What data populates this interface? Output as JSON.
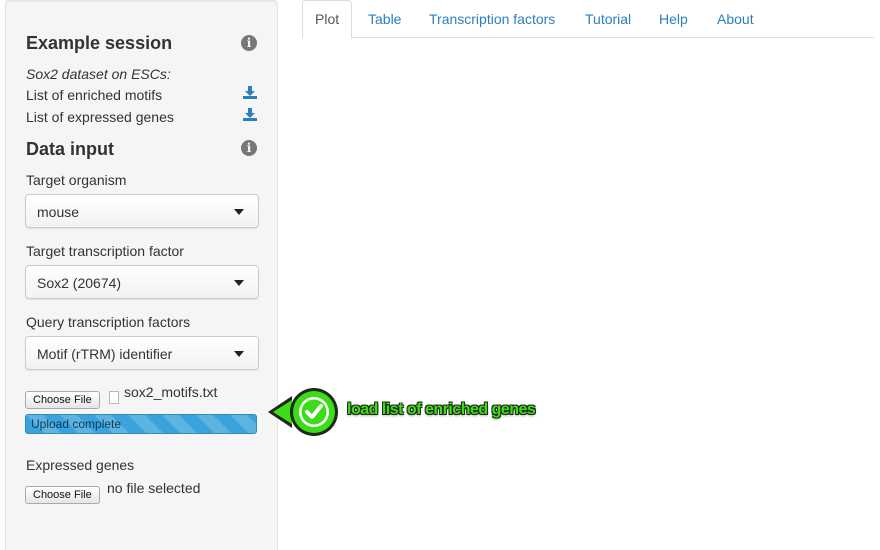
{
  "tabs": [
    {
      "label": "Plot",
      "active": true
    },
    {
      "label": "Table"
    },
    {
      "label": "Transcription factors"
    },
    {
      "label": "Tutorial"
    },
    {
      "label": "Help"
    },
    {
      "label": "About"
    }
  ],
  "sidebar": {
    "example_session": {
      "title": "Example session",
      "info_icon": "info-icon",
      "subtitle": "Sox2 dataset on ESCs:",
      "links": [
        {
          "label": "List of enriched motifs",
          "icon": "download-icon"
        },
        {
          "label": "List of expressed genes",
          "icon": "download-icon"
        }
      ]
    },
    "data_input": {
      "title": "Data input",
      "info_icon": "info-icon",
      "target_organism": {
        "label": "Target organism",
        "value": "mouse"
      },
      "target_tf": {
        "label": "Target transcription factor",
        "value": "Sox2 (20674)"
      },
      "query_tfs": {
        "label": "Query transcription factors",
        "value": "Motif (rTRM) identifier"
      },
      "motif_upload": {
        "button": "Choose File",
        "file_name": "sox2_motifs.txt",
        "progress_text": "Upload complete",
        "progress": 1.0
      },
      "expressed_genes": {
        "label": "Expressed genes",
        "button": "Choose File",
        "file_name": "no file selected"
      }
    }
  },
  "annotation": {
    "text": "load list of enriched genes",
    "icon": "checkmark-icon",
    "color": "#3ddc1a"
  },
  "colors": {
    "link": "#2a7fbf",
    "sidebar_bg": "#f5f5f5",
    "progress": "#3aa3db"
  }
}
